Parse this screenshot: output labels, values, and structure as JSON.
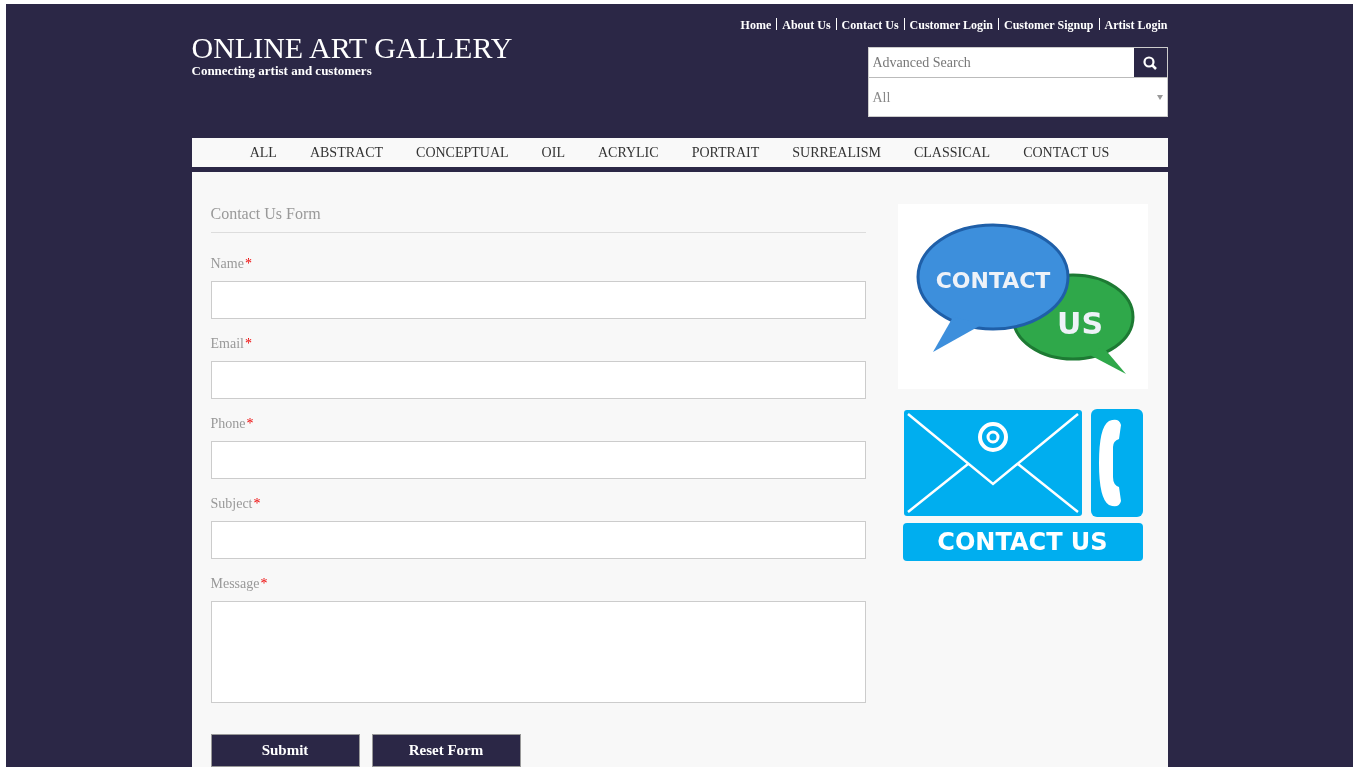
{
  "top_links": [
    "Home",
    "About Us",
    "Contact Us",
    "Customer Login",
    "Customer Signup",
    "Artist Login"
  ],
  "brand": {
    "title": "ONLINE ART GALLERY",
    "tagline": "Connecting artist and customers"
  },
  "search": {
    "placeholder": "Advanced Search",
    "category": "All"
  },
  "nav": [
    {
      "label": "ALL",
      "selected": false
    },
    {
      "label": "ABSTRACT",
      "selected": false
    },
    {
      "label": "CONCEPTUAL",
      "selected": false
    },
    {
      "label": "OIL",
      "selected": false
    },
    {
      "label": "ACRYLIC",
      "selected": false
    },
    {
      "label": "PORTRAIT",
      "selected": false
    },
    {
      "label": "SURREALISM",
      "selected": false
    },
    {
      "label": "CLASSICAL",
      "selected": false
    },
    {
      "label": "CONTACT US",
      "selected": false
    }
  ],
  "form": {
    "title": "Contact Us Form",
    "fields": [
      {
        "label": "Name",
        "mark": "*",
        "kind": "input"
      },
      {
        "label": "Email",
        "mark": "*",
        "kind": "input"
      },
      {
        "label": "Phone",
        "mark": "*",
        "kind": "input"
      },
      {
        "label": "Subject",
        "mark": "*",
        "kind": "input"
      },
      {
        "label": "Message",
        "mark": "*",
        "kind": "textarea"
      }
    ],
    "buttons": [
      "Submit",
      "Reset Form"
    ]
  },
  "images": [
    {
      "kind": "bubbles",
      "texts": [
        "CONTACT",
        "US"
      ]
    },
    {
      "kind": "envelope",
      "texts": [
        "CONTACT US"
      ]
    }
  ]
}
